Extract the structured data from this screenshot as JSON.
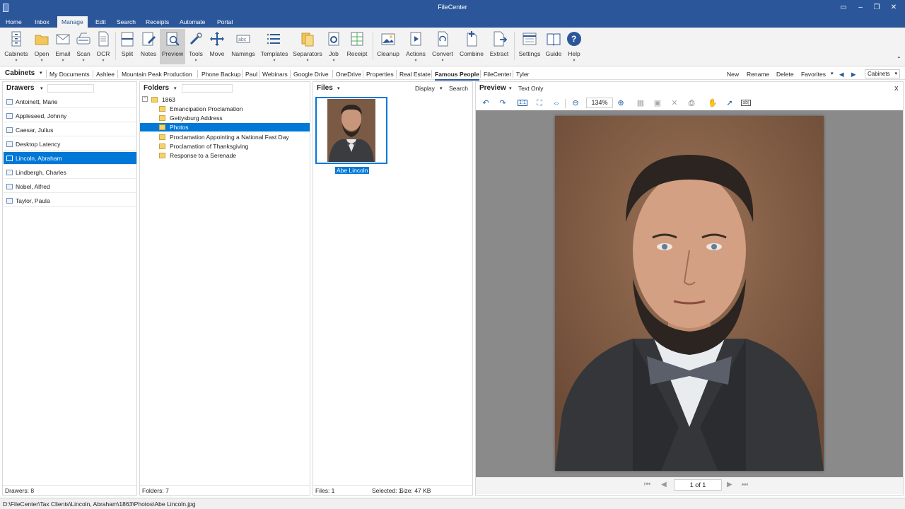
{
  "window": {
    "title": "FileCenter"
  },
  "ribbon_tabs": [
    "Home",
    "Inbox",
    "Manage",
    "Edit",
    "Search",
    "Receipts",
    "Automate",
    "Portal"
  ],
  "active_ribbon_tab": "Manage",
  "ribbon_buttons": [
    {
      "label": "Cabinets",
      "icon": "cabinet-icon",
      "dropdown": true
    },
    {
      "label": "Open",
      "icon": "folder-open-icon",
      "dropdown": true
    },
    {
      "label": "Email",
      "icon": "envelope-icon",
      "dropdown": true
    },
    {
      "label": "Scan",
      "icon": "scanner-icon",
      "dropdown": true
    },
    {
      "label": "OCR",
      "icon": "ocr-document-icon",
      "dropdown": true
    },
    {
      "label": "Split",
      "icon": "split-icon",
      "dropdown": false
    },
    {
      "label": "Notes",
      "icon": "notes-icon",
      "dropdown": false
    },
    {
      "label": "Preview",
      "icon": "magnifier-document-icon",
      "dropdown": false,
      "active": true
    },
    {
      "label": "Tools",
      "icon": "tools-icon",
      "dropdown": true
    },
    {
      "label": "Move",
      "icon": "move-arrows-icon",
      "dropdown": false
    },
    {
      "label": "Namings",
      "icon": "abc-naming-icon",
      "dropdown": false
    },
    {
      "label": "Templates",
      "icon": "template-list-icon",
      "dropdown": true
    },
    {
      "label": "Separators",
      "icon": "separator-pages-icon",
      "dropdown": true
    },
    {
      "label": "Job",
      "icon": "job-gear-icon",
      "dropdown": true
    },
    {
      "label": "Receipt",
      "icon": "receipt-grid-icon",
      "dropdown": false
    },
    {
      "label": "Cleanup",
      "icon": "cleanup-image-icon",
      "dropdown": false
    },
    {
      "label": "Actions",
      "icon": "actions-play-icon",
      "dropdown": true
    },
    {
      "label": "Convert",
      "icon": "convert-document-icon",
      "dropdown": true
    },
    {
      "label": "Combine",
      "icon": "combine-plus-icon",
      "dropdown": false
    },
    {
      "label": "Extract",
      "icon": "extract-arrow-icon",
      "dropdown": false
    },
    {
      "label": "Settings",
      "icon": "settings-window-icon",
      "dropdown": false
    },
    {
      "label": "Guide",
      "icon": "guide-book-icon",
      "dropdown": false
    },
    {
      "label": "Help",
      "icon": "help-question-icon",
      "dropdown": true
    }
  ],
  "cabinet_bar": {
    "label": "Cabinets",
    "tabs": [
      "My Documents",
      "Ashlee",
      "Mountain Peak Production",
      "Phone Backup",
      "Paul",
      "Webinars",
      "Google Drive",
      "OneDrive",
      "Properties",
      "Real Estate",
      "Famous People",
      "FileCenter",
      "Tyler"
    ],
    "active": "Famous People",
    "actions": [
      "New",
      "Rename",
      "Delete",
      "Favorites"
    ],
    "selector": "Cabinets"
  },
  "drawers": {
    "title": "Drawers",
    "items": [
      "Antoinett, Marie",
      "Appleseed, Johnny",
      "Caesar, Julius",
      "Desktop Latency",
      "Lincoln, Abraham",
      "Lindbergh, Charles",
      "Nobel, Alfred",
      "Taylor, Paula"
    ],
    "selected": "Lincoln, Abraham",
    "footer": "Drawers: 8"
  },
  "folders": {
    "title": "Folders",
    "root": "1863",
    "items": [
      "Emancipation Proclamation",
      "Gettysburg Address",
      "Photos",
      "Proclamation Appointing a National Fast Day",
      "Proclamation of Thanksgiving",
      "Response to a Serenade"
    ],
    "selected": "Photos",
    "footer": "Folders: 7"
  },
  "files": {
    "title": "Files",
    "display": "Display",
    "search": "Search",
    "items": [
      {
        "name": "Abe Lincoln",
        "selected": true
      }
    ],
    "footer": {
      "count": "Files: 1",
      "selected": "Selected: 1",
      "size": "Size: 47 KB"
    }
  },
  "preview": {
    "title": "Preview",
    "text_only": "Text Only",
    "close": "X",
    "zoom": "134%",
    "page": "1 of 1"
  },
  "status_bar": {
    "path": "D:\\FileCenter\\Tax Clients\\Lincoln, Abraham\\1863\\Photos\\Abe Lincoln.jpg"
  }
}
